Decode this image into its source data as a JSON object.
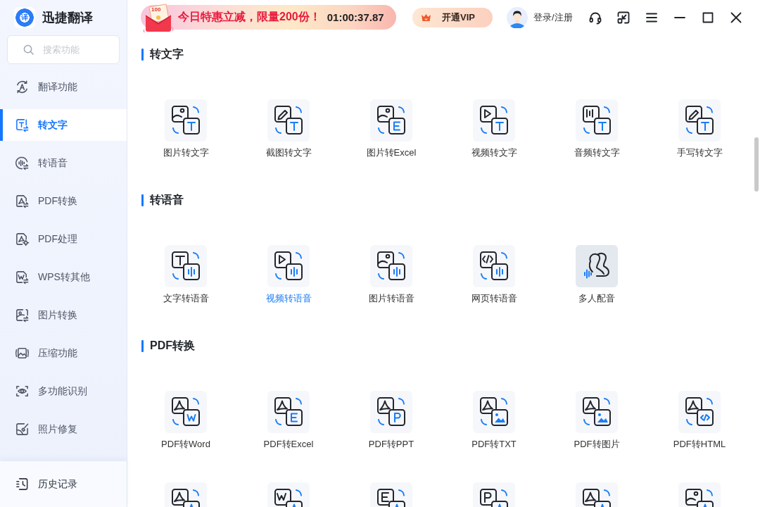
{
  "app": {
    "logo_glyph": "译",
    "name": "迅捷翻译"
  },
  "search": {
    "placeholder": "搜索功能"
  },
  "sidebar": {
    "items": [
      {
        "label": "翻译功能",
        "selected": false
      },
      {
        "label": "转文字",
        "selected": true
      },
      {
        "label": "转语音",
        "selected": false
      },
      {
        "label": "PDF转换",
        "selected": false
      },
      {
        "label": "PDF处理",
        "selected": false
      },
      {
        "label": "WPS转其他",
        "selected": false
      },
      {
        "label": "图片转换",
        "selected": false
      },
      {
        "label": "压缩功能",
        "selected": false
      },
      {
        "label": "多功能识别",
        "selected": false
      },
      {
        "label": "照片修复",
        "selected": false
      }
    ],
    "footer": {
      "label": "历史记录"
    }
  },
  "topbar": {
    "promo": {
      "coupon": "100",
      "text": "今日特惠立减，限量200份！",
      "countdown": "01:00:37.87"
    },
    "vip_button": "开通VIP",
    "login": "登录/注册"
  },
  "sections": [
    {
      "title": "转文字",
      "tiles": [
        {
          "label": "图片转文字",
          "selected": false,
          "hovered": false
        },
        {
          "label": "截图转文字",
          "selected": false,
          "hovered": false
        },
        {
          "label": "图片转Excel",
          "selected": false,
          "hovered": false
        },
        {
          "label": "视频转文字",
          "selected": false,
          "hovered": false
        },
        {
          "label": "音频转文字",
          "selected": false,
          "hovered": false
        },
        {
          "label": "手写转文字",
          "selected": false,
          "hovered": false
        }
      ]
    },
    {
      "title": "转语音",
      "tiles": [
        {
          "label": "文字转语音",
          "selected": false,
          "hovered": false
        },
        {
          "label": "视频转语音",
          "selected": true,
          "hovered": false
        },
        {
          "label": "图片转语音",
          "selected": false,
          "hovered": false
        },
        {
          "label": "网页转语音",
          "selected": false,
          "hovered": false
        },
        {
          "label": "多人配音",
          "selected": false,
          "hovered": true
        }
      ]
    },
    {
      "title": "PDF转换",
      "tiles": [
        {
          "label": "PDF转Word",
          "selected": false,
          "hovered": false
        },
        {
          "label": "PDF转Excel",
          "selected": false,
          "hovered": false
        },
        {
          "label": "PDF转PPT",
          "selected": false,
          "hovered": false
        },
        {
          "label": "PDF转TXT",
          "selected": false,
          "hovered": false
        },
        {
          "label": "PDF转图片",
          "selected": false,
          "hovered": false
        },
        {
          "label": "PDF转HTML",
          "selected": false,
          "hovered": false
        },
        {
          "hovered": false
        },
        {
          "hovered": false
        },
        {
          "hovered": false
        },
        {
          "hovered": false
        },
        {
          "hovered": false
        },
        {
          "hovered": false
        }
      ]
    }
  ]
}
